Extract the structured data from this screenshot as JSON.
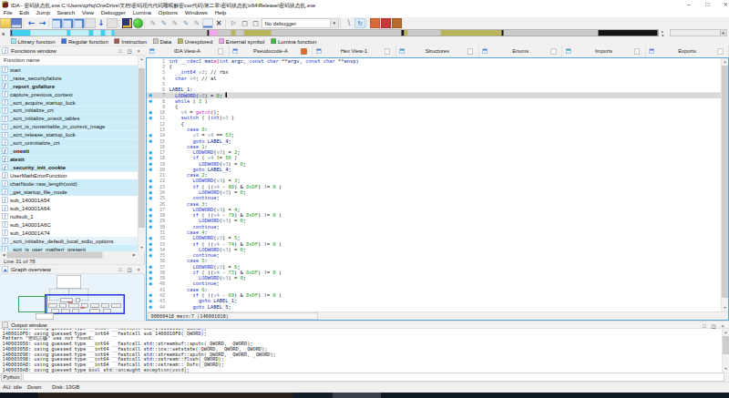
{
  "window": {
    "title": "IDA - 密码状态机.exe C:\\Users\\qzhq\\OneDrive\\文档\\密码现代代码睡眠解密csv代码\\第二章\\密码状态机\\x64\\Release\\密码状态机.exe",
    "minimize": "–",
    "maximize": "□",
    "close": "×"
  },
  "menu": {
    "items": [
      "File",
      "Edit",
      "Jump",
      "Search",
      "View",
      "Debugger",
      "Lumina",
      "Options",
      "Windows",
      "Help"
    ]
  },
  "toolbar": {
    "items": [
      {
        "name": "open-file-icon",
        "kind": "folder"
      },
      {
        "name": "save-icon",
        "kind": "floppy"
      },
      {
        "kind": "sep"
      },
      {
        "name": "back-icon",
        "kind": "arrowl",
        "g": "←"
      },
      {
        "name": "forward-icon",
        "kind": "arrowr",
        "g": "→"
      },
      {
        "kind": "sep"
      },
      {
        "name": "jump-icon-1",
        "kind": "blue"
      },
      {
        "name": "jump-icon-2",
        "kind": "blue"
      },
      {
        "name": "jump-icon-3",
        "kind": "blue"
      },
      {
        "name": "jump-icon-4",
        "kind": "grayjump"
      },
      {
        "name": "jump-down-icon",
        "kind": "arrowd",
        "g": "↓"
      },
      {
        "name": "undo-icon",
        "kind": "grayjump"
      },
      {
        "kind": "sep"
      },
      {
        "name": "snapshot-icon",
        "kind": "shot"
      },
      {
        "name": "lumina-icon",
        "kind": "ball"
      },
      {
        "kind": "sep"
      },
      {
        "name": "edit-icon-1",
        "kind": "pencil",
        "g": "✎"
      },
      {
        "name": "edit-icon-2",
        "kind": "pencil2",
        "g": "✎"
      },
      {
        "name": "edit-icon-3",
        "kind": "pencil",
        "g": "✎"
      },
      {
        "name": "edit-icon-4",
        "kind": "pencil2",
        "g": "✎"
      },
      {
        "name": "edit-icon-5",
        "kind": "pencil",
        "g": "✎"
      },
      {
        "name": "chart-icon",
        "kind": "chart"
      },
      {
        "name": "delete-icon",
        "kind": "cross",
        "g": "×"
      },
      {
        "kind": "sep"
      },
      {
        "name": "debug-run-icon",
        "kind": "play",
        "g": "▷"
      },
      {
        "name": "debug-pause-icon",
        "kind": "sq",
        "g": "□"
      },
      {
        "name": "debug-stop-icon",
        "kind": "sq",
        "g": "□"
      },
      {
        "name": "debugger-select",
        "kind": "combo",
        "label": "No debugger"
      },
      {
        "kind": "sep"
      },
      {
        "name": "tool-icon-1",
        "kind": "slash",
        "g": "\\"
      },
      {
        "name": "tool-icon-2",
        "kind": "refresh",
        "g": "↻"
      },
      {
        "kind": "sep"
      },
      {
        "name": "dbg-icon-1",
        "kind": "redA"
      },
      {
        "name": "dbg-icon-2",
        "kind": "redB"
      },
      {
        "name": "dbg-icon-3",
        "kind": "redC"
      }
    ]
  },
  "navband": {
    "segments": [
      [
        0,
        4,
        "#1b2f73"
      ],
      [
        4,
        40,
        "#3fd0f2"
      ],
      [
        44,
        80,
        "#c2eef8"
      ],
      [
        124,
        8,
        "#3fd0f2"
      ],
      [
        132,
        40,
        "#c2eef8"
      ],
      [
        172,
        10,
        "#3fd0f2"
      ],
      [
        182,
        16,
        "#c2eef8"
      ],
      [
        198,
        10,
        "#3fd0f2"
      ],
      [
        208,
        14,
        "#c2eef8"
      ],
      [
        222,
        6,
        "#3fd0f2"
      ],
      [
        432,
        4,
        "#151515"
      ],
      [
        436,
        18,
        "#f2a6ec"
      ],
      [
        484,
        10,
        "#b9b35e"
      ],
      [
        512,
        60,
        "#b9b35e"
      ],
      [
        858,
        6,
        "#151515"
      ],
      [
        864,
        8,
        "#b9b35e"
      ],
      [
        944,
        134,
        "#b9b35e"
      ],
      [
        1078,
        4,
        "#151515"
      ],
      [
        1290,
        130,
        "#151515"
      ]
    ],
    "up_glyph": "▸",
    "down_glyph": "◂"
  },
  "legend": {
    "items": [
      {
        "label": "Library function",
        "color": "#9ceefc"
      },
      {
        "label": "Regular function",
        "color": "#3a6fe8"
      },
      {
        "label": "Instruction",
        "color": "#a2574d"
      },
      {
        "label": "Data",
        "color": "#c9c9c9"
      },
      {
        "label": "Unexplored",
        "color": "#b9b35e"
      },
      {
        "label": "External symbol",
        "color": "#f2a6ec"
      },
      {
        "label": "Lumina function",
        "color": "#3db93d"
      }
    ]
  },
  "functions_window": {
    "title": "Functions window",
    "header": "Function name",
    "status": "Line 31 of 78",
    "items": [
      {
        "name": "start",
        "lib": true
      },
      {
        "name": "_raise_securityfailure",
        "lib": true
      },
      {
        "name": "_report_gsfailure",
        "lib": true,
        "bold": true
      },
      {
        "name": "capture_previous_context",
        "lib": true
      },
      {
        "name": "_scrt_acquire_startup_lock",
        "lib": true
      },
      {
        "name": "_scrt_initialize_crt",
        "lib": true
      },
      {
        "name": "_scrt_initialize_onexit_tables",
        "lib": true
      },
      {
        "name": "_scrt_is_nonwritable_in_current_image",
        "lib": true
      },
      {
        "name": "_scrt_release_startup_lock",
        "lib": true
      },
      {
        "name": "_scrt_uninitialize_crt",
        "lib": true
      },
      {
        "name": "_onexit",
        "lib": true,
        "bold": true
      },
      {
        "name": "atexit",
        "lib": true,
        "bold": true
      },
      {
        "name": "_security_init_cookie",
        "lib": true,
        "bold": true
      },
      {
        "name": "UserMathErrorFunction",
        "lib": false
      },
      {
        "name": "charNode::raw_length(void)",
        "lib": true
      },
      {
        "name": "_get_startup_file_mode",
        "lib": true
      },
      {
        "name": "sub_140001A54",
        "lib": false
      },
      {
        "name": "sub_140001A64",
        "lib": false
      },
      {
        "name": "nullsub_1",
        "lib": false
      },
      {
        "name": "sub_140001A6C",
        "lib": false
      },
      {
        "name": "sub_140001A74",
        "lib": false
      },
      {
        "name": "_scrt_initialize_default_local_stdio_options",
        "lib": true,
        "selected": true
      },
      {
        "name": "_scrt_is_user_matherr_present",
        "lib": true
      }
    ]
  },
  "graph_overview": {
    "title": "Graph overview"
  },
  "tabs": {
    "items": [
      {
        "label": "IDA View-A",
        "accent": "#4a7fd0"
      },
      {
        "label": "Pseudocode-A",
        "accent": "#4a7fd0",
        "active": true
      },
      {
        "label": "Hex View-1",
        "accent": "#4a7fd0"
      },
      {
        "label": "Structures",
        "accent": "#3f97b0"
      },
      {
        "label": "Enums",
        "accent": "#4a7fd0"
      },
      {
        "label": "Imports",
        "accent": "#3f97b0"
      },
      {
        "label": "Exports",
        "accent": "#7a6fd0"
      }
    ]
  },
  "pseudocode": {
    "status": "00000418 main:7 (140001018)",
    "current_line": 7,
    "dotted_lines": [
      7,
      8,
      10,
      11,
      14,
      15,
      17,
      18,
      19,
      20,
      22,
      23,
      24,
      25,
      27,
      28,
      29,
      30,
      32,
      33,
      34,
      35,
      37,
      38,
      39,
      40,
      42,
      43,
      44
    ],
    "lines": [
      "int __cdecl main(int argc, const char **argv, const char **envp)",
      "{",
      "  __int64 v3; // rbx",
      "  char v4; // al",
      "",
      "LABEL_1:",
      "  LODWORD(v3) = 0;",
      "  while ( 2 )",
      "  {",
      "    v4 = getch();",
      "    switch ( (int)v3 )",
      "    {",
      "      case 0:",
      "        v3 = v4 == 53;",
      "        goto LABEL_4;",
      "      case 1:",
      "        LODWORD(v3) = 2;",
      "        if ( v4 != 50 )",
      "          LODWORD(v3) = 0;",
      "        goto LABEL_4;",
      "      case 2:",
      "        LODWORD(v3) = 3;",
      "        if ( ((v4 - 80) & 0xDF) != 0 )",
      "          LODWORD(v3) = 0;",
      "        continue;",
      "      case 3:",
      "        LODWORD(v3) = 4;",
      "        if ( ((v4 - 79) & 0xDF) != 0 )",
      "          LODWORD(v3) = 0;",
      "        continue;",
      "      case 4:",
      "        LODWORD(v3) = 5;",
      "        if ( ((v4 - 74) & 0xDF) != 0 )",
      "          LODWORD(v3) = 0;",
      "        continue;",
      "      case 5:",
      "        LODWORD(v3) = 6;",
      "        if ( ((v4 - 73) & 0xDF) != 0 )",
      "          LODWORD(v3) = 0;",
      "        continue;",
      "      case 6:",
      "        if ( ((v4 - 69) & 0xDF) != 0 )",
      "          goto LABEL_1;",
      "        goto LABEL_5;"
    ]
  },
  "output_window": {
    "title": "Output window",
    "clipped_line": "140001010: using guessed type __int64 __fastcall sub_140001010(_QWORD);",
    "lines": [
      "1400010F0: using guessed type __int64 __fastcall sub_1400010F0(_QWORD);",
      "Pattern \"密码正确\" was not found.",
      "140003050: using guessed type __int64 __fastcall std::streambuf::sputc(_QWORD, _QWORD);",
      "140003058: using guessed type __int64 __fastcall std::ios::setstate(_QWORD, _QWORD, _QWORD);",
      "140003090: using guessed type __int64 __fastcall std::streambuf::sputn(_QWORD, _QWORD, _QWORD);",
      "140003098: using guessed type __int64 __fastcall std::ostream::flush(_QWORD);",
      "1400030A0: using guessed type __int64 __fastcall std::ostream::_Osfx(_QWORD);",
      "1400030A8: using guessed type bool std::uncaught_exception(void);"
    ]
  },
  "python": {
    "label": "Python",
    "value": ""
  },
  "statusbar": {
    "au": "AU: idle",
    "state": "Down",
    "disk": "Disk: 13GB"
  }
}
